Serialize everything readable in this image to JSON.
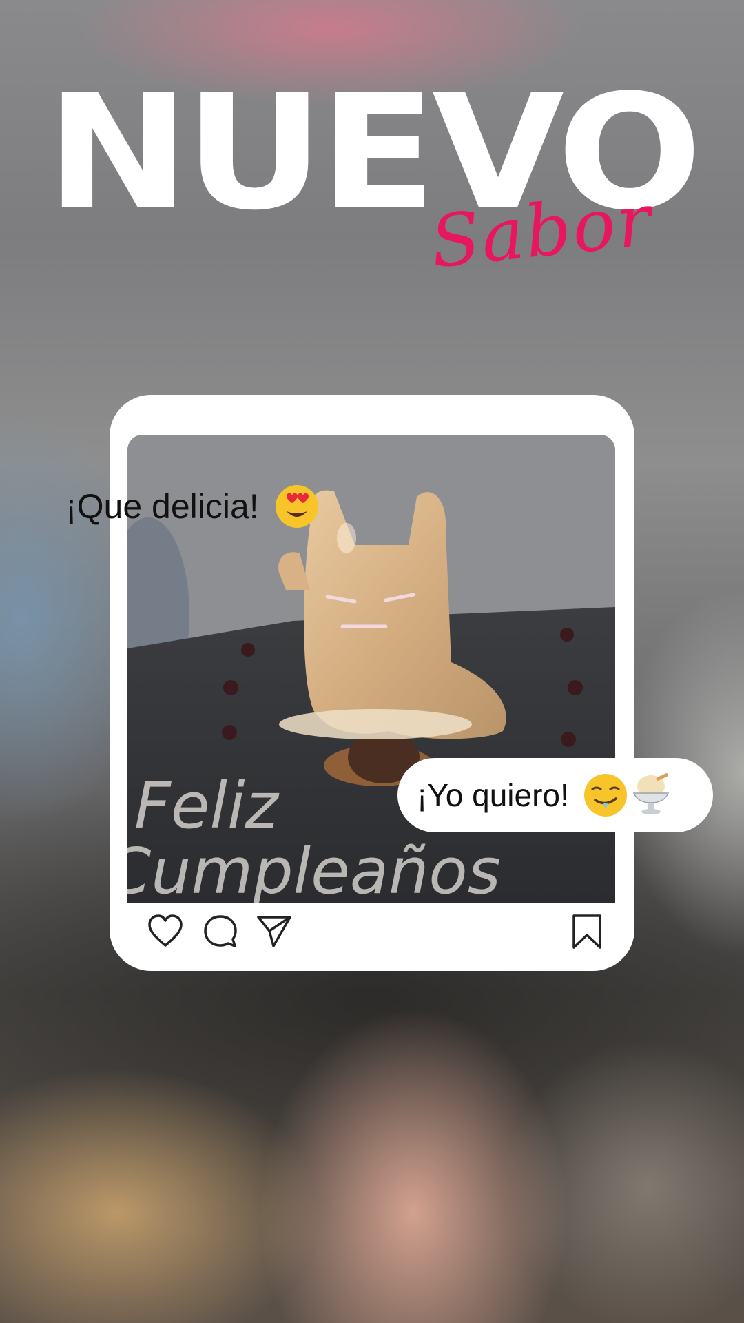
{
  "header": {
    "title": "NUEVO",
    "subtitle": "Sabor"
  },
  "post": {
    "photo_caption_line1": "Feliz",
    "photo_caption_line2": "Cumpleaños",
    "actions": {
      "like_icon": "heart-outline-icon",
      "comment_icon": "speech-bubble-icon",
      "share_icon": "paper-plane-icon",
      "save_icon": "bookmark-icon"
    }
  },
  "comments": [
    {
      "text": "¡Que delicia!",
      "emoji": "heart-eyes-emoji"
    },
    {
      "text": "¡Yo quiero!",
      "emoji": [
        "drooling-face-emoji",
        "ice-cream-emoji"
      ]
    }
  ],
  "colors": {
    "title": "#ffffff",
    "subtitle_accent": "#e8175d",
    "frame": "#ffffff",
    "text": "#111111"
  }
}
